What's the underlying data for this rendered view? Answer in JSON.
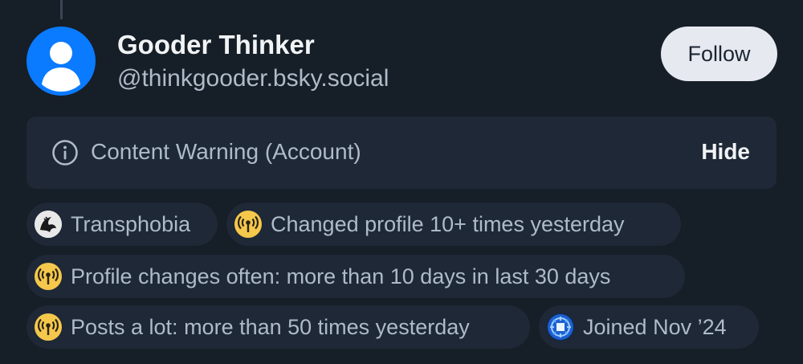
{
  "profile": {
    "display_name": "Gooder Thinker",
    "handle": "@thinkgooder.bsky.social",
    "avatar_color": "#0a7aff"
  },
  "actions": {
    "follow_label": "Follow"
  },
  "content_warning": {
    "text": "Content Warning (Account)",
    "hide_label": "Hide",
    "icon": "info-icon"
  },
  "labels": [
    {
      "text": "Transphobia",
      "icon": "transphobia-labeler-icon"
    },
    {
      "text": "Changed profile 10+ times yesterday",
      "icon": "broadcast-icon"
    },
    {
      "text": "Profile changes often: more than 10 days in last 30 days",
      "icon": "broadcast-icon"
    },
    {
      "text": "Posts a lot: more than 50 times yesterday",
      "icon": "broadcast-icon"
    },
    {
      "text": "Joined Nov ’24",
      "icon": "blue-labeler-icon"
    }
  ],
  "colors": {
    "background": "#161e27",
    "surface": "#1e2836",
    "text_primary": "#f1f3f5",
    "text_secondary": "#aebbc9",
    "broadcast_yellow": "#f5c84c",
    "accent_blue": "#0a7aff"
  }
}
